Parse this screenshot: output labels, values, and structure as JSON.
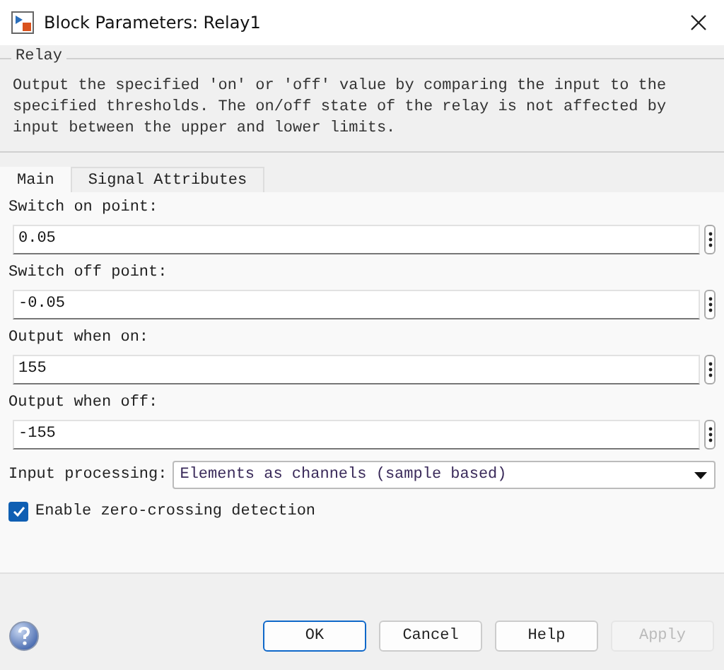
{
  "window": {
    "title": "Block Parameters: Relay1"
  },
  "group": {
    "title": "Relay",
    "description": "Output the specified 'on' or 'off' value by comparing the input to the specified thresholds.  The on/off state of the relay is not affected by input between the upper and lower limits."
  },
  "tabs": [
    {
      "label": "Main",
      "selected": true
    },
    {
      "label": "Signal Attributes",
      "selected": false
    }
  ],
  "parameters": [
    {
      "label": "Switch on point:",
      "value": "0.05"
    },
    {
      "label": "Switch off point:",
      "value": "-0.05"
    },
    {
      "label": "Output when on:",
      "value": "155"
    },
    {
      "label": "Output when off:",
      "value": "-155"
    }
  ],
  "input_processing": {
    "label": "Input processing:",
    "value": "Elements as channels (sample based)"
  },
  "zero_crossing": {
    "label": "Enable zero-crossing detection",
    "checked": true
  },
  "buttons": [
    {
      "label": "OK",
      "default": true,
      "disabled": false
    },
    {
      "label": "Cancel",
      "default": false,
      "disabled": false
    },
    {
      "label": "Help",
      "default": false,
      "disabled": false
    },
    {
      "label": "Apply",
      "default": false,
      "disabled": true
    }
  ]
}
